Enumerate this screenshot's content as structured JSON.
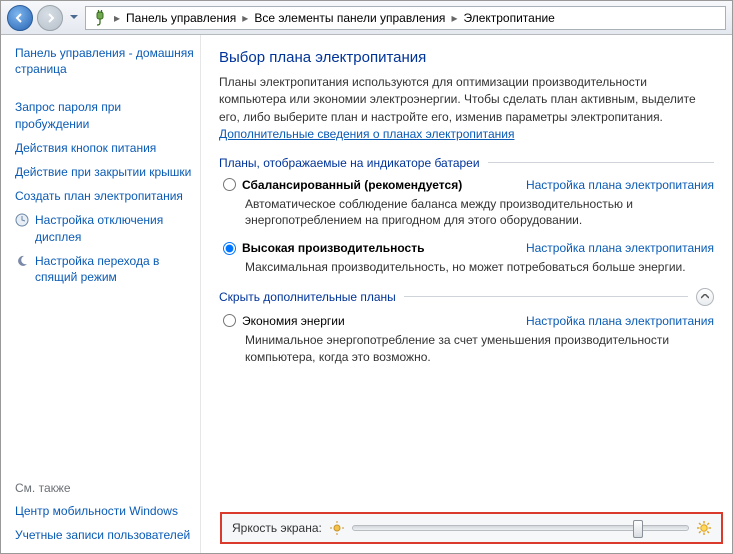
{
  "breadcrumb": {
    "root": "Панель управления",
    "mid": "Все элементы панели управления",
    "leaf": "Электропитание"
  },
  "sidebar": {
    "home": "Панель управления - домашняя страница",
    "wake_password": "Запрос пароля при пробуждении",
    "power_buttons": "Действия кнопок питания",
    "lid_close": "Действие при закрытии крышки",
    "create_plan": "Создать план электропитания",
    "display_off": "Настройка отключения дисплея",
    "sleep_mode": "Настройка перехода в спящий режим",
    "also_header": "См. также",
    "mobility": "Центр мобильности Windows",
    "accounts": "Учетные записи пользователей"
  },
  "content": {
    "title": "Выбор плана электропитания",
    "intro_text": "Планы электропитания используются для оптимизации производительности компьютера или экономии электроэнергии. Чтобы сделать план активным, выделите его, либо выберите план и настройте его, изменив параметры электропитания. ",
    "intro_link": "Дополнительные сведения о планах электропитания",
    "battery_header": "Планы, отображаемые на индикаторе батареи",
    "hide_header": "Скрыть дополнительные планы",
    "plan_link_label": "Настройка плана электропитания",
    "plans": {
      "balanced": {
        "name": "Сбалансированный (рекомендуется)",
        "desc": "Автоматическое соблюдение баланса между производительностью и энергопотреблением на пригодном для этого оборудовании."
      },
      "high": {
        "name": "Высокая производительность",
        "desc": "Максимальная производительность, но может потребоваться больше энергии."
      },
      "saver": {
        "name": "Экономия энергии",
        "desc": "Минимальное энергопотребление за счет уменьшения производительности компьютера, когда это возможно."
      }
    }
  },
  "brightness": {
    "label": "Яркость экрана:",
    "value_percent": 85
  }
}
